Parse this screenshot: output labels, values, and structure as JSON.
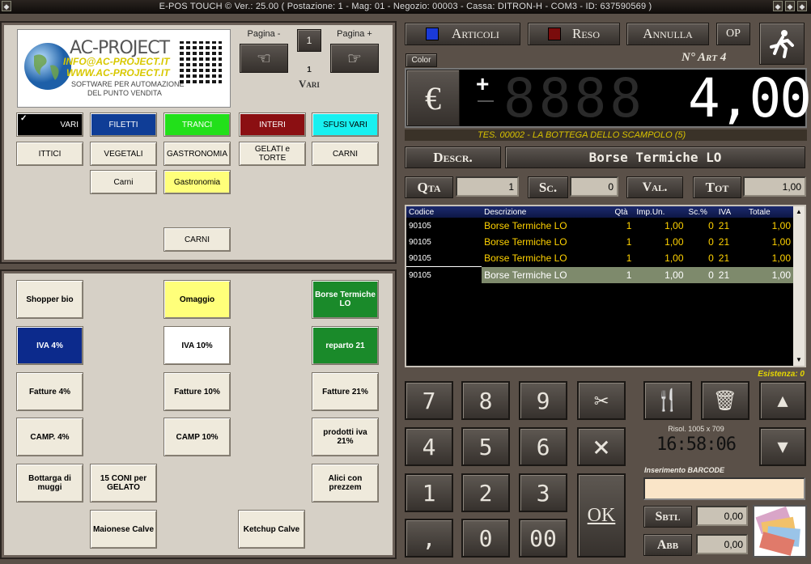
{
  "window": {
    "title": "E-POS  TOUCH ©  Ver.: 25.00      ( Postazione: 1 - Mag: 01 - Negozio: 00003 - Cassa: DITRON-H - COM3 - ID: 637590569 )"
  },
  "logo": {
    "brand": "AC-PROJECT",
    "email": "INFO@AC-PROJECT.IT",
    "web": "WWW.AC-PROJECT.IT",
    "tagline1": "SOFTWARE PER AUTOMAZIONE",
    "tagline2": "DEL PUNTO VENDITA"
  },
  "pager": {
    "prev_label": "Pagina -",
    "next_label": "Pagina +",
    "page_box": "1",
    "page_number": "1",
    "page_name": "Vari"
  },
  "categories_row1": [
    {
      "label": "VARI",
      "bg": "#000000",
      "fg": "#ffffff"
    },
    {
      "label": "FILETTI",
      "bg": "#0f3d96",
      "fg": "#ffffff"
    },
    {
      "label": "TRANCI",
      "bg": "#22e01a",
      "fg": "#ffffff"
    },
    {
      "label": "INTERI",
      "bg": "#8b0f12",
      "fg": "#ffffff"
    },
    {
      "label": "SFUSI VARI",
      "bg": "#18f0f0",
      "fg": "#000000"
    }
  ],
  "categories_row2": [
    "ITTICI",
    "VEGETALI",
    "GASTRONOMIA",
    "GELATI e TORTE",
    "CARNI"
  ],
  "categories_row3": [
    "Carni",
    "Gastronomia"
  ],
  "categories_row4": [
    "CARNI"
  ],
  "products": {
    "shopper_bio": "Shopper bio",
    "omaggio": "Omaggio",
    "borse_termiche": "Borse Termiche LO",
    "iva4": "IVA 4%",
    "iva10": "IVA 10%",
    "reparto21": "reparto 21",
    "fatture4": "Fatture 4%",
    "fatture10": "Fatture 10%",
    "fatture21": "Fatture 21%",
    "camp4": "CAMP. 4%",
    "camp10": "CAMP 10%",
    "prodotti21": "prodotti iva 21%",
    "bottarga": "Bottarga di muggi",
    "coni": "15 CONI per GELATO",
    "alici": "Alici con prezzem",
    "maionese": "Maionese Calve",
    "ketchup": "Ketchup Calve"
  },
  "colors": {
    "omaggio": "#ffff7a",
    "iva4": "#0c2a8c",
    "green": "#1a8a2a",
    "gastronomia": "#ffff7a"
  },
  "top_buttons": {
    "articoli": "Articoli",
    "reso": "Reso",
    "annulla": "Annulla",
    "op": "OP",
    "color": "Color"
  },
  "article_count": "N° Art 4",
  "display": {
    "sign": "+",
    "amount": "4,00",
    "currency_icon": "euro-icon"
  },
  "ticker": "TES. 00002 - LA BOTTEGA DELLO SCAMPOLO (5)",
  "descr": {
    "label": "Descr.",
    "value": "Borse Termiche LO"
  },
  "qty_row": {
    "qta_label": "Qta",
    "qta_value": "1",
    "sc_label": "Sc.",
    "sc_value": "0",
    "val_label": "Val.",
    "tot_label": "Tot",
    "tot_value": "1,00"
  },
  "table": {
    "headers": [
      "Codice",
      "Descrizione",
      "Qtà",
      "Imp.Un.",
      "Sc.%",
      "IVA",
      "Totale"
    ],
    "rows": [
      [
        "90105",
        "Borse Termiche LO",
        "1",
        "1,00",
        "0",
        "21",
        "1,00"
      ],
      [
        "90105",
        "Borse Termiche LO",
        "1",
        "1,00",
        "0",
        "21",
        "1,00"
      ],
      [
        "90105",
        "Borse Termiche LO",
        "1",
        "1,00",
        "0",
        "21",
        "1,00"
      ],
      [
        "90105",
        "Borse Termiche LO",
        "1",
        "1,00",
        "0",
        "21",
        "1,00"
      ]
    ]
  },
  "esistenza": "Esistenza: 0",
  "keypad": {
    "k7": "7",
    "k8": "8",
    "k9": "9",
    "k4": "4",
    "k5": "5",
    "k6": "6",
    "k1": "1",
    "k2": "2",
    "k3": "3",
    "comma": ",",
    "k0": "0",
    "k00": "00",
    "ok": "OK",
    "times": "×"
  },
  "info": {
    "resolution": "Risol. 1005 x 709",
    "clock": "16:58:06",
    "barcode_label": "Inserimento  BARCODE",
    "barcode_value": ""
  },
  "totals": {
    "sbtl_label": "Sbtl",
    "sbtl_value": "0,00",
    "abb_label": "Abb",
    "abb_value": "0,00"
  }
}
